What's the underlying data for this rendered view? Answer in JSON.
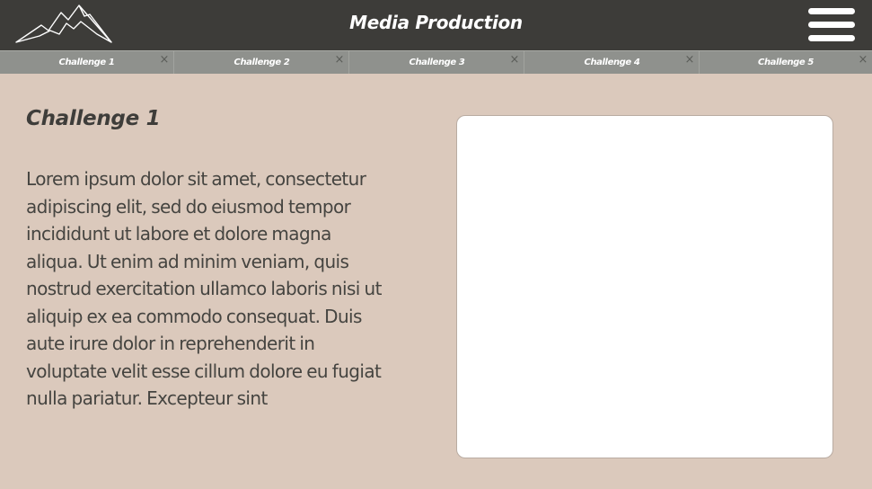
{
  "header": {
    "title": "Media Production",
    "logo_icon": "mountain-logo-icon",
    "menu_icon": "hamburger-menu-icon"
  },
  "tabs": [
    {
      "label": "Challenge 1",
      "close_glyph": "×"
    },
    {
      "label": "Challenge 2",
      "close_glyph": "×"
    },
    {
      "label": "Challenge 3",
      "close_glyph": "×"
    },
    {
      "label": "Challenge 4",
      "close_glyph": "×"
    },
    {
      "label": "Challenge 5",
      "close_glyph": "×"
    }
  ],
  "main": {
    "title": "Challenge 1",
    "body": "Lorem ipsum dolor sit amet, consectetur adipiscing elit, sed do eiusmod tempor incididunt ut labore et dolore magna aliqua. Ut enim ad minim veniam, quis nostrud exercitation ullamco laboris nisi ut aliquip ex ea commodo consequat. Duis aute irure dolor in reprehenderit in voluptate velit esse cillum dolore eu fugiat nulla pariatur. Excepteur sint"
  },
  "colors": {
    "header_bg": "#3d3c39",
    "tabbar_bg": "#8f918d",
    "page_bg": "#dbc9bc",
    "panel_bg": "#ffffff",
    "text": "#454440"
  }
}
